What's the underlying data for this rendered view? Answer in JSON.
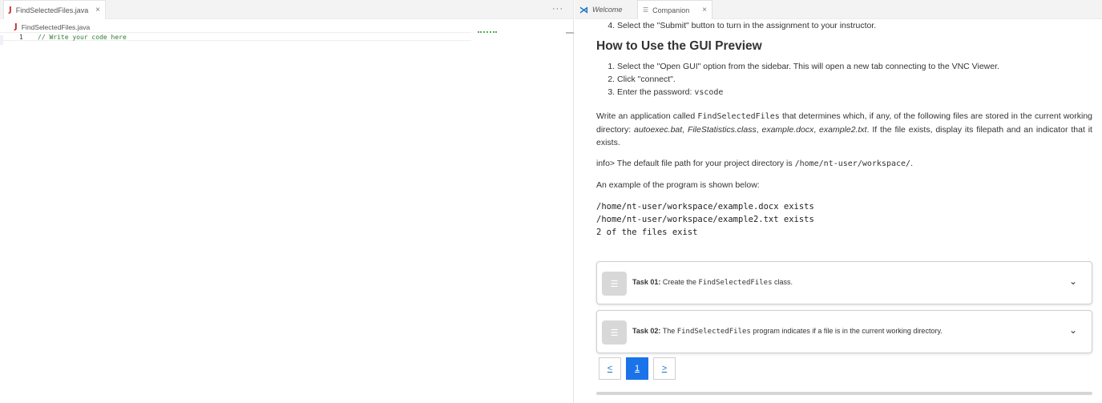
{
  "editor": {
    "tab_label": "FindSelectedFiles.java",
    "tab_close": "×",
    "more": "···",
    "breadcrumb": "FindSelectedFiles.java",
    "java_icon": "J",
    "lines": [
      {
        "num": "1",
        "text": "// Write your code here"
      }
    ]
  },
  "companion": {
    "tabs": [
      {
        "label": "Welcome",
        "icon": "vscode-icon"
      },
      {
        "label": "Companion",
        "icon": "preview-icon",
        "close": "×"
      }
    ],
    "step4_prefix": "Select the \"Submit\" button to turn in the assignment to your instructor.",
    "gui_heading": "How to Use the GUI Preview",
    "gui_steps": [
      "Select the \"Open GUI\" option from the sidebar. This will open a new tab connecting to the VNC Viewer.",
      "Click \"connect\".",
      "Enter the password: "
    ],
    "password": "vscode",
    "desc": {
      "part1": "Write an application called ",
      "class_name": "FindSelectedFiles",
      "part2": " that determines which, if any, of the following files are stored in the current working directory: ",
      "f1": "autoexec.bat",
      "sep1": ", ",
      "f2": "FileStatistics.class",
      "sep2": ", ",
      "f3": "example.docx",
      "sep3": ", ",
      "f4": "example2.txt",
      "part3": ". If the file exists, display its filepath and an indicator that it exists."
    },
    "info": {
      "prefix": "info> The default file path for your project directory is ",
      "path": "/home/nt-user/workspace/",
      "suffix": "."
    },
    "example_intro": "An example of the program is shown below:",
    "example_lines": [
      "/home/nt-user/workspace/example.docx exists",
      "/home/nt-user/workspace/example2.txt exists",
      "2 of the files exist"
    ],
    "tasks": [
      {
        "label": "Task 01:",
        "pre": " Create the ",
        "code": "FindSelectedFiles",
        "post": " class."
      },
      {
        "label": "Task 02:",
        "pre": " The ",
        "code": "FindSelectedFiles",
        "post": " program indicates if a file is in the current working directory."
      }
    ],
    "pager": {
      "prev": "<",
      "current": "1",
      "next": ">"
    }
  }
}
